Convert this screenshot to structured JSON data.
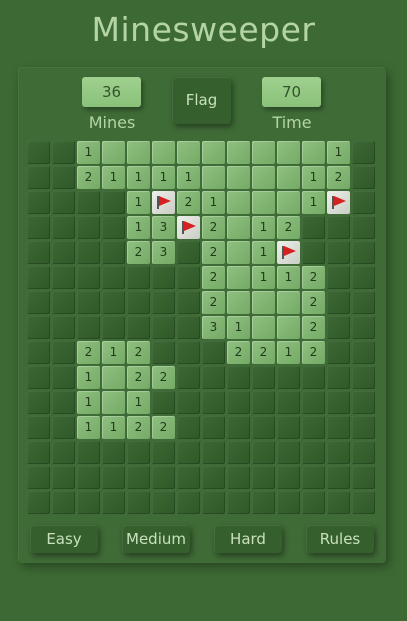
{
  "title": "Minesweeper",
  "mines": {
    "value": "36",
    "label": "Mines"
  },
  "time": {
    "value": "70",
    "label": "Time"
  },
  "flag_button": "Flag",
  "board": {
    "rows": [
      "..1.........1.",
      "..2.1.1.1.1..12.",
      "....1F21...1F.",
      "....13F2.12...",
      "....23..2.1F..",
      "........2.112.",
      "........2...2.",
      "........31..2.",
      "..212.....2212.",
      "..1.22........",
      "..1.1.........",
      "..1122........",
      "..............",
      "..............",
      ".............."
    ],
    "grid": [
      [
        "H",
        "H",
        "1",
        "O",
        "O",
        "O",
        "O",
        "O",
        "O",
        "O",
        "O",
        "O",
        "1",
        "H"
      ],
      [
        "H",
        "H",
        "2",
        "1",
        "1",
        "1",
        "1",
        "O",
        "O",
        "O",
        "O",
        "1",
        "2",
        "H"
      ],
      [
        "H",
        "H",
        "H",
        "H",
        "1",
        "F",
        "2",
        "1",
        "O",
        "O",
        "O",
        "1",
        "F",
        "H"
      ],
      [
        "H",
        "H",
        "H",
        "H",
        "1",
        "3",
        "F",
        "2",
        "O",
        "1",
        "2",
        "H",
        "H",
        "H"
      ],
      [
        "H",
        "H",
        "H",
        "H",
        "2",
        "3",
        "H",
        "2",
        "O",
        "1",
        "F",
        "H",
        "H",
        "H"
      ],
      [
        "H",
        "H",
        "H",
        "H",
        "H",
        "H",
        "H",
        "2",
        "O",
        "1",
        "1",
        "2",
        "H",
        "H"
      ],
      [
        "H",
        "H",
        "H",
        "H",
        "H",
        "H",
        "H",
        "2",
        "O",
        "O",
        "O",
        "2",
        "H",
        "H"
      ],
      [
        "H",
        "H",
        "H",
        "H",
        "H",
        "H",
        "H",
        "3",
        "1",
        "O",
        "O",
        "2",
        "H",
        "H"
      ],
      [
        "H",
        "H",
        "2",
        "1",
        "2",
        "H",
        "H",
        "H",
        "2",
        "2",
        "1",
        "2",
        "H",
        "H"
      ],
      [
        "H",
        "H",
        "1",
        "O",
        "2",
        "2",
        "H",
        "H",
        "H",
        "H",
        "H",
        "H",
        "H",
        "H"
      ],
      [
        "H",
        "H",
        "1",
        "O",
        "1",
        "H",
        "H",
        "H",
        "H",
        "H",
        "H",
        "H",
        "H",
        "H"
      ],
      [
        "H",
        "H",
        "1",
        "1",
        "2",
        "2",
        "H",
        "H",
        "H",
        "H",
        "H",
        "H",
        "H",
        "H"
      ],
      [
        "H",
        "H",
        "H",
        "H",
        "H",
        "H",
        "H",
        "H",
        "H",
        "H",
        "H",
        "H",
        "H",
        "H"
      ],
      [
        "H",
        "H",
        "H",
        "H",
        "H",
        "H",
        "H",
        "H",
        "H",
        "H",
        "H",
        "H",
        "H",
        "H"
      ],
      [
        "H",
        "H",
        "H",
        "H",
        "H",
        "H",
        "H",
        "H",
        "H",
        "H",
        "H",
        "H",
        "H",
        "H"
      ]
    ]
  },
  "levels": [
    "Easy",
    "Medium",
    "Hard",
    "Rules"
  ],
  "colors": {
    "background": "#3d6a34",
    "revealed": "#85b876",
    "hidden": "#35602d",
    "flag": "#d42222"
  },
  "icons": {
    "flag": "flag-icon"
  }
}
